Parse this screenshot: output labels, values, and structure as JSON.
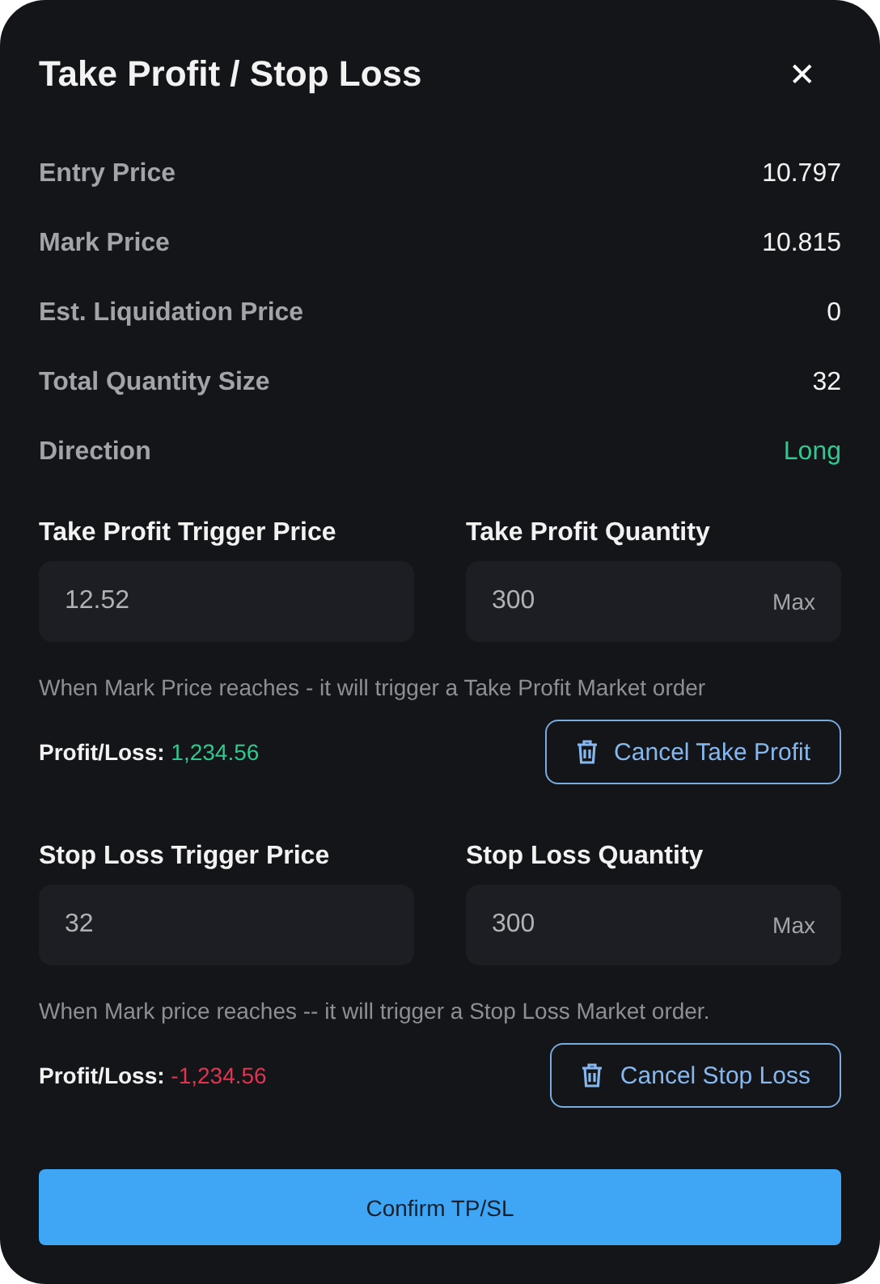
{
  "dialog": {
    "title": "Take Profit / Stop Loss",
    "close": "✕"
  },
  "summary": [
    {
      "label": "Entry Price",
      "value": "10.797"
    },
    {
      "label": "Mark Price",
      "value": "10.815"
    },
    {
      "label": "Est. Liquidation Price",
      "value": "0"
    },
    {
      "label": "Total Quantity Size",
      "value": "32"
    },
    {
      "label": "Direction",
      "value": "Long",
      "color": "#2fc98f"
    }
  ],
  "sections": [
    {
      "price_label": "Take Profit Trigger Price",
      "price": "12.52",
      "quantity_label": "Take Profit Quantity",
      "quantity": "300",
      "max": "Max",
      "hint": "When Mark Price reaches - it will trigger a Take Profit Market order",
      "pnl": {
        "label": "Profit/Loss:",
        "value": "1,234.56",
        "color": "#2fc98f"
      },
      "cancel": "Cancel Take Profit"
    },
    {
      "price_label": "Stop Loss Trigger Price",
      "price": "32",
      "quantity_label": "Stop Loss Quantity",
      "quantity": "300",
      "max": "Max",
      "hint": "When Mark price reaches -- it will trigger a Stop Loss Market order.",
      "pnl": {
        "label": "Profit/Loss:",
        "value": "-1,234.56",
        "color": "#e2344f"
      },
      "cancel": "Cancel Stop Loss"
    }
  ],
  "confirm": "Confirm TP/SL"
}
